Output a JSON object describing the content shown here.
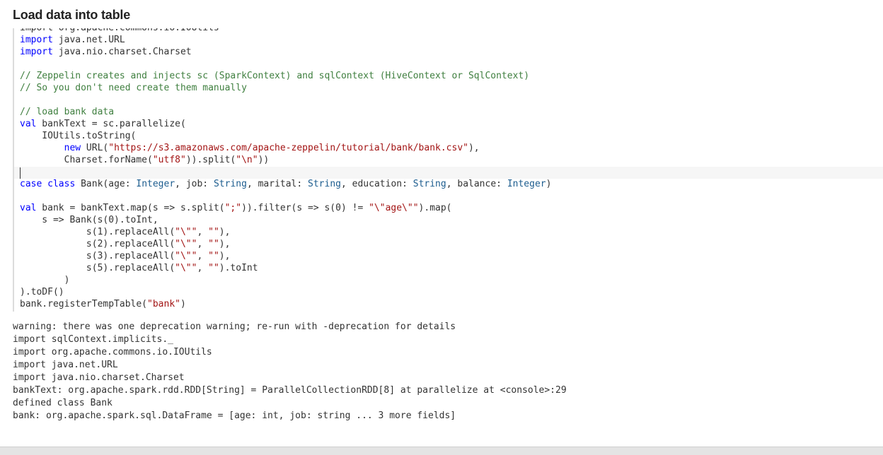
{
  "paragraph": {
    "title": "Load data into table"
  },
  "editor": {
    "lines": [
      {
        "segments": [
          {
            "t": "import org.apache.commons.io.IOUtils",
            "c": ""
          }
        ]
      },
      {
        "segments": [
          {
            "t": "import",
            "c": "kw"
          },
          {
            "t": " java.net.URL",
            "c": ""
          }
        ]
      },
      {
        "segments": [
          {
            "t": "import",
            "c": "kw"
          },
          {
            "t": " java.nio.charset.Charset",
            "c": ""
          }
        ]
      },
      {
        "segments": []
      },
      {
        "segments": [
          {
            "t": "// Zeppelin creates and injects sc (SparkContext) and sqlContext (HiveContext or SqlContext)",
            "c": "cmt"
          }
        ]
      },
      {
        "segments": [
          {
            "t": "// So you don't need create them manually",
            "c": "cmt"
          }
        ]
      },
      {
        "segments": []
      },
      {
        "segments": [
          {
            "t": "// load bank data",
            "c": "cmt"
          }
        ]
      },
      {
        "segments": [
          {
            "t": "val",
            "c": "kw"
          },
          {
            "t": " bankText = sc.parallelize(",
            "c": ""
          }
        ]
      },
      {
        "segments": [
          {
            "t": "    IOUtils.toString(",
            "c": ""
          }
        ]
      },
      {
        "segments": [
          {
            "t": "        ",
            "c": ""
          },
          {
            "t": "new",
            "c": "kw"
          },
          {
            "t": " URL(",
            "c": ""
          },
          {
            "t": "\"https://s3.amazonaws.com/apache-zeppelin/tutorial/bank/bank.csv\"",
            "c": "str"
          },
          {
            "t": "),",
            "c": ""
          }
        ]
      },
      {
        "segments": [
          {
            "t": "        Charset.forName(",
            "c": ""
          },
          {
            "t": "\"utf8\"",
            "c": "str"
          },
          {
            "t": ")).split(",
            "c": ""
          },
          {
            "t": "\"\\n\"",
            "c": "str"
          },
          {
            "t": "))",
            "c": ""
          }
        ]
      },
      {
        "segments": []
      },
      {
        "segments": [
          {
            "t": "case",
            "c": "kw"
          },
          {
            "t": " ",
            "c": ""
          },
          {
            "t": "class",
            "c": "kw"
          },
          {
            "t": " Bank(age: ",
            "c": ""
          },
          {
            "t": "Integer",
            "c": "tp"
          },
          {
            "t": ", job: ",
            "c": ""
          },
          {
            "t": "String",
            "c": "tp"
          },
          {
            "t": ", marital: ",
            "c": ""
          },
          {
            "t": "String",
            "c": "tp"
          },
          {
            "t": ", education: ",
            "c": ""
          },
          {
            "t": "String",
            "c": "tp"
          },
          {
            "t": ", balance: ",
            "c": ""
          },
          {
            "t": "Integer",
            "c": "tp"
          },
          {
            "t": ")",
            "c": ""
          }
        ]
      },
      {
        "segments": []
      },
      {
        "segments": [
          {
            "t": "val",
            "c": "kw"
          },
          {
            "t": " bank = bankText.map(s => s.split(",
            "c": ""
          },
          {
            "t": "\";\"",
            "c": "str"
          },
          {
            "t": ")).filter(s => s(0) != ",
            "c": ""
          },
          {
            "t": "\"\\\"age\\\"\"",
            "c": "str"
          },
          {
            "t": ").map(",
            "c": ""
          }
        ]
      },
      {
        "segments": [
          {
            "t": "    s => Bank(s(0).toInt,",
            "c": ""
          }
        ]
      },
      {
        "segments": [
          {
            "t": "            s(1).replaceAll(",
            "c": ""
          },
          {
            "t": "\"\\\"\"",
            "c": "str"
          },
          {
            "t": ", ",
            "c": ""
          },
          {
            "t": "\"\"",
            "c": "str"
          },
          {
            "t": "),",
            "c": ""
          }
        ]
      },
      {
        "segments": [
          {
            "t": "            s(2).replaceAll(",
            "c": ""
          },
          {
            "t": "\"\\\"\"",
            "c": "str"
          },
          {
            "t": ", ",
            "c": ""
          },
          {
            "t": "\"\"",
            "c": "str"
          },
          {
            "t": "),",
            "c": ""
          }
        ]
      },
      {
        "segments": [
          {
            "t": "            s(3).replaceAll(",
            "c": ""
          },
          {
            "t": "\"\\\"\"",
            "c": "str"
          },
          {
            "t": ", ",
            "c": ""
          },
          {
            "t": "\"\"",
            "c": "str"
          },
          {
            "t": "),",
            "c": ""
          }
        ]
      },
      {
        "segments": [
          {
            "t": "            s(5).replaceAll(",
            "c": ""
          },
          {
            "t": "\"\\\"\"",
            "c": "str"
          },
          {
            "t": ", ",
            "c": ""
          },
          {
            "t": "\"\"",
            "c": "str"
          },
          {
            "t": ").toInt",
            "c": ""
          }
        ]
      },
      {
        "segments": [
          {
            "t": "        )",
            "c": ""
          }
        ]
      },
      {
        "segments": [
          {
            "t": ").toDF()",
            "c": ""
          }
        ]
      },
      {
        "segments": [
          {
            "t": "bank.registerTempTable(",
            "c": ""
          },
          {
            "t": "\"bank\"",
            "c": "str"
          },
          {
            "t": ")",
            "c": ""
          }
        ]
      }
    ]
  },
  "output": {
    "lines": [
      "warning: there was one deprecation warning; re-run with -deprecation for details",
      "import sqlContext.implicits._",
      "import org.apache.commons.io.IOUtils",
      "import java.net.URL",
      "import java.nio.charset.Charset",
      "bankText: org.apache.spark.rdd.RDD[String] = ParallelCollectionRDD[8] at parallelize at <console>:29",
      "defined class Bank",
      "bank: org.apache.spark.sql.DataFrame = [age: int, job: string ... 3 more fields]"
    ]
  }
}
